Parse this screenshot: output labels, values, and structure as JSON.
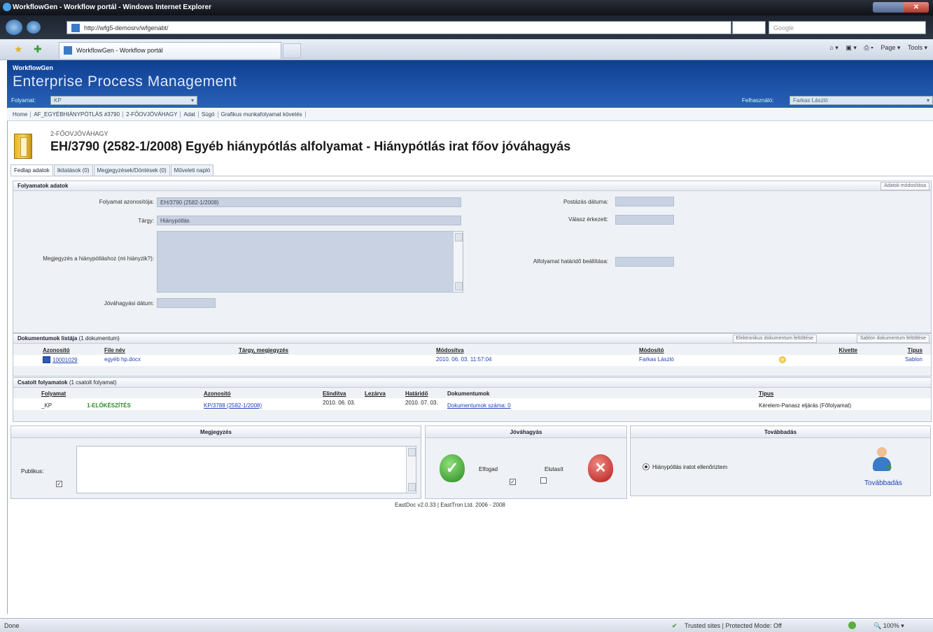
{
  "browser": {
    "window_title": "WorkflowGen - Workflow portál - Windows Internet Explorer",
    "address": "http://wfg5-demosrv/wfgenabt/",
    "search_placeholder": "Google",
    "tab_title": "WorkflowGen - Workflow portál",
    "cmd_page": "Page ▾",
    "cmd_tools": "Tools ▾",
    "status_left": "Done",
    "status_zone": "Trusted sites | Protected Mode: Off",
    "zoom": "100%"
  },
  "banner": {
    "brand_small": "WorkflowGen",
    "brand_large": "Enterprise Process Management",
    "process_label": "Folyamat:",
    "process_value": "KP",
    "user_label": "Felhasználó:",
    "user_value": "Farkas László"
  },
  "breadcrumb": [
    "Home",
    "AF_EGYÉBHIÁNYPÓTLÁS #3790",
    "2-FŐOVJÓVÁHAGY",
    "Adat",
    "Súgó",
    "Grafikus munkafolyamat követés"
  ],
  "header": {
    "step": "2-FŐOVJÓVÁHAGY",
    "title": "EH/3790 (2582-1/2008) Egyéb hiánypótlás alfolyamat - Hiánypótlás irat főov jóváhagyás"
  },
  "tabs": [
    "Fedlap adatok",
    "Ikitatások (0)",
    "Megjegyzések/Döntések (0)",
    "Műveleti napló"
  ],
  "process_data": {
    "section_title": "Folyamatok adatok",
    "button": "Adatok módosítása",
    "id_label": "Folyamat azonosítója:",
    "id_value": "EH/3790 (2582-1/2008)",
    "subject_label": "Tárgy:",
    "subject_value": "Hiánypótlás",
    "note_label": "Megjegyzés a hiánypótláshoz (mi hiányzik?):",
    "approval_label": "Jóváhagyási dátum:",
    "post_label": "Postázás dátuma:",
    "reply_label": "Válasz érkezett:",
    "deadline_label": "Alfolyamat határidő beállítása:"
  },
  "documents": {
    "section_title": "Dokumentumok listája",
    "section_count": "(1 dokumentum)",
    "btn_upload_electronic": "Elektronikus dokumentum feltöltése",
    "btn_upload_template": "Sablon dokumentum feltöltése",
    "headers": [
      "Azonosító",
      "File név",
      "Tárgy, megjegyzés",
      "Módosítva",
      "Módosító",
      "Kivette",
      "Típus"
    ],
    "rows": [
      {
        "id": "10001029",
        "file": "egyéb hp.docx",
        "subject": "",
        "modified": "2010. 06. 03. 11:57:04",
        "modifier": "Farkas László",
        "taken": "",
        "type": "Sablon"
      }
    ]
  },
  "linked": {
    "section_title": "Csatolt folyamatok",
    "section_count": "(1 csatolt folyamat)",
    "headers": [
      "Folyamat",
      "Azonosító",
      "Elindítva",
      "Lezárva",
      "Határidő",
      "Dokumentumok",
      "Típus"
    ],
    "rows": [
      {
        "process": "_KP",
        "step": "1-ELŐKÉSZÍTÉS",
        "id": "KP/3788 (2582-1/2008)",
        "started": "2010. 06. 03.",
        "closed": "",
        "deadline": "2010. 07. 03.",
        "docs": "Dokumentumok száma: 0",
        "type": "Kérelem-Panasz eljárás (Főfolyamat)"
      }
    ]
  },
  "comment_panel": {
    "title": "Megjegyzés",
    "public_label": "Publikus:"
  },
  "approval_panel": {
    "title": "Jóváhagyás",
    "accept_label": "Elfogad",
    "reject_label": "Elutasít"
  },
  "forward_panel": {
    "title": "Továbbadás",
    "option_label": "Hiánypótlás iratot ellenőriztem",
    "button": "Továbbadás"
  },
  "footer": "EastDoc v2.0.33  |  EastTron Ltd. 2006 - 2008",
  "colors": {
    "banner": "#1a4fa8",
    "section": "#eef1f5",
    "link": "#2343b8",
    "approve": "#3a9a2a",
    "reject": "#c8282a"
  }
}
